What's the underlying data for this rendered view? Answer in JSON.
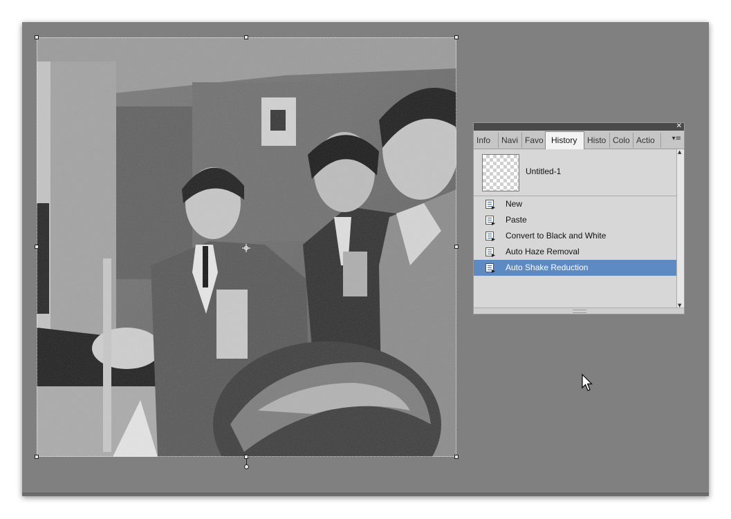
{
  "panel": {
    "tabs": [
      "Info",
      "Navi",
      "Favo",
      "History",
      "Histo",
      "Colo",
      "Actio"
    ],
    "active_tab": "History",
    "menu_icon": "panel-menu-icon",
    "close_icon": "close-icon",
    "snapshot_label": "Untitled-1",
    "history_items": [
      {
        "label": "New",
        "selected": false
      },
      {
        "label": "Paste",
        "selected": false
      },
      {
        "label": "Convert to Black and White",
        "selected": false
      },
      {
        "label": "Auto Haze Removal",
        "selected": false
      },
      {
        "label": "Auto Shake Reduction",
        "selected": true
      }
    ]
  },
  "colors": {
    "canvas_background": "#808080",
    "selection": "#5d8ac2"
  }
}
